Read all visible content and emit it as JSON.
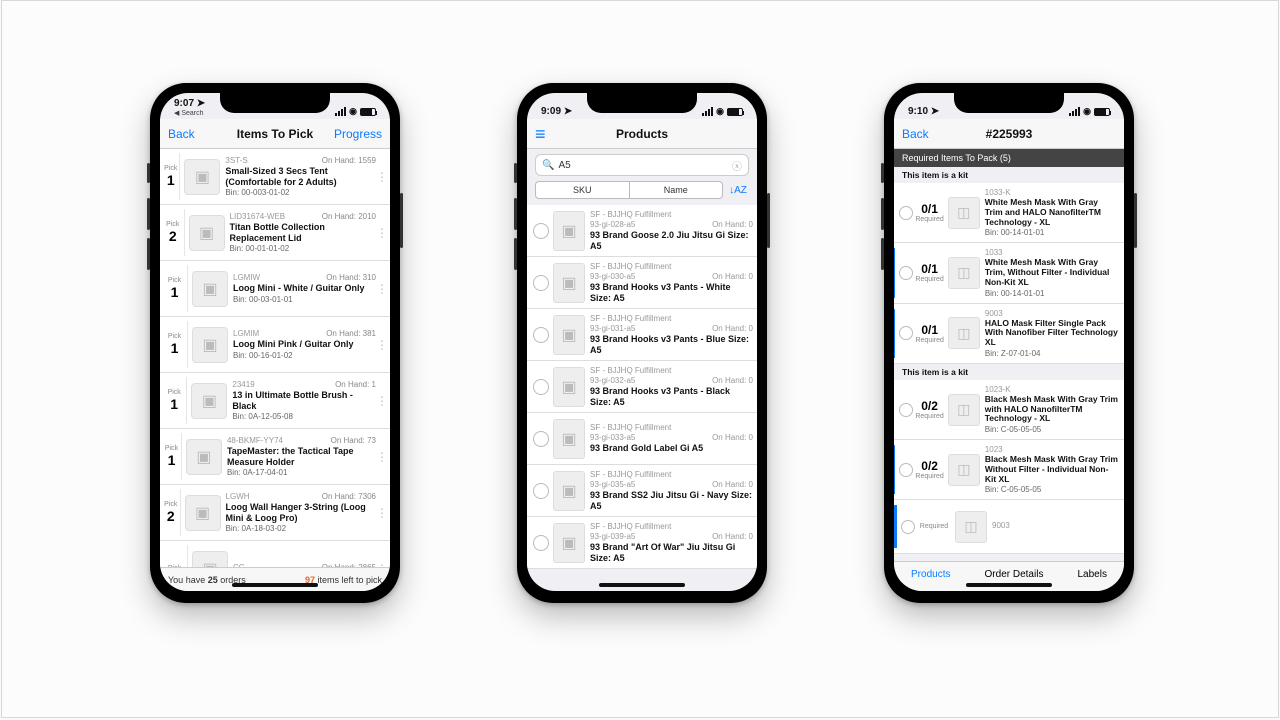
{
  "phones": [
    {
      "time": "9:07",
      "breadcrumb": "◀ Search",
      "nav": {
        "back": "Back",
        "title": "Items To Pick",
        "right": "Progress"
      },
      "footer": {
        "orders_prefix": "You have ",
        "orders_count": "25",
        "orders_suffix": " orders",
        "items_count": "97",
        "items_suffix": " items left to pick"
      },
      "rows": [
        {
          "pick": "1",
          "sku": "3ST-S",
          "on_hand": "On Hand: 1559",
          "name": "Small-Sized 3 Secs Tent (Comfortable for 2 Adults)",
          "bin": "Bin: 00-003-01-02"
        },
        {
          "pick": "2",
          "sku": "LID31674-WEB",
          "on_hand": "On Hand: 2010",
          "name": "Titan Bottle Collection Replacement Lid",
          "bin": "Bin: 00-01-01-02"
        },
        {
          "pick": "1",
          "sku": "LGMIW",
          "on_hand": "On Hand: 310",
          "name": "Loog Mini - White / Guitar Only",
          "bin": "Bin: 00-03-01-01"
        },
        {
          "pick": "1",
          "sku": "LGMIM",
          "on_hand": "On Hand: 381",
          "name": "Loog Mini Pink / Guitar Only",
          "bin": "Bin: 00-16-01-02"
        },
        {
          "pick": "1",
          "sku": "23419",
          "on_hand": "On Hand: 1",
          "name": "13 in Ultimate Bottle Brush - Black",
          "bin": "Bin: 0A-12-05-08"
        },
        {
          "pick": "1",
          "sku": "48-BKMF-YY74",
          "on_hand": "On Hand: 73",
          "name": "TapeMaster: the Tactical Tape Measure Holder",
          "bin": "Bin: 0A-17-04-01"
        },
        {
          "pick": "2",
          "sku": "LGWH",
          "on_hand": "On Hand: 7306",
          "name": "Loog Wall Hanger 3-String (Loog Mini & Loog Pro)",
          "bin": "Bin: 0A-18-03-02"
        },
        {
          "pick": "",
          "sku": "CC",
          "on_hand": "On Hand: 2865",
          "name": "",
          "bin": ""
        }
      ]
    },
    {
      "time": "9:09",
      "nav": {
        "menu": "≡",
        "title": "Products"
      },
      "search": "A5",
      "segments": {
        "a": "SKU",
        "b": "Name",
        "sort": "↓AZ"
      },
      "rows": [
        {
          "vendor": "SF - BJJHQ Fulfillment",
          "sku": "93-gi-028-a5",
          "on_hand": "On Hand: 0",
          "name": "93 Brand Goose 2.0 Jiu Jitsu Gi  Size: A5"
        },
        {
          "vendor": "SF - BJJHQ Fulfillment",
          "sku": "93-gi-030-a5",
          "on_hand": "On Hand: 0",
          "name": "93 Brand Hooks v3 Pants - White Size: A5"
        },
        {
          "vendor": "SF - BJJHQ Fulfillment",
          "sku": "93-gi-031-a5",
          "on_hand": "On Hand: 0",
          "name": "93 Brand Hooks v3 Pants - Blue Size: A5"
        },
        {
          "vendor": "SF - BJJHQ Fulfillment",
          "sku": "93-gi-032-a5",
          "on_hand": "On Hand: 0",
          "name": "93 Brand Hooks v3 Pants - Black Size: A5"
        },
        {
          "vendor": "SF - BJJHQ Fulfillment",
          "sku": "93-gi-033-a5",
          "on_hand": "On Hand: 0",
          "name": "93 Brand Gold Label Gi A5"
        },
        {
          "vendor": "SF - BJJHQ Fulfillment",
          "sku": "93-gi-035-a5",
          "on_hand": "On Hand: 0",
          "name": "93 Brand SS2 Jiu Jitsu Gi - Navy Size: A5"
        },
        {
          "vendor": "SF - BJJHQ Fulfillment",
          "sku": "93-gi-039-a5",
          "on_hand": "On Hand: 0",
          "name": "93 Brand \"Art Of War\" Jiu Jitsu Gi Size: A5"
        }
      ]
    },
    {
      "time": "9:10",
      "nav": {
        "back": "Back",
        "title": "#225993"
      },
      "header": "Required Items To Pack (5)",
      "kit_label": "This item is a kit",
      "rows1": [
        {
          "req": "0/1",
          "sku": "1033-K",
          "name": "White Mesh Mask With Gray Trim and HALO NanofilterTM Technology - XL",
          "bin": "Bin: 00-14-01-01",
          "sub": false
        },
        {
          "req": "0/1",
          "sku": "1033",
          "name": "White Mesh Mask With Gray Trim, Without Filter - Individual Non-Kit XL",
          "bin": "Bin: 00-14-01-01",
          "sub": true
        },
        {
          "req": "0/1",
          "sku": "9003",
          "name": "HALO Mask Filter Single Pack With Nanofiber Filter Technology XL",
          "bin": "Bin: Z-07-01-04",
          "sub": true
        }
      ],
      "rows2": [
        {
          "req": "0/2",
          "sku": "1023-K",
          "name": "Black Mesh Mask With Gray Trim with HALO NanofilterTM Technology - XL",
          "bin": "Bin: C-05-05-05",
          "sub": false
        },
        {
          "req": "0/2",
          "sku": "1023",
          "name": "Black Mesh Mask With Gray Trim Without Filter - Individual Non-Kit XL",
          "bin": "Bin: C-05-05-05",
          "sub": true
        },
        {
          "req": "",
          "sku": "9003",
          "name": "",
          "bin": "",
          "sub": true
        }
      ],
      "tabs": {
        "a": "Products",
        "b": "Order Details",
        "c": "Labels"
      },
      "required_label": "Required"
    }
  ]
}
